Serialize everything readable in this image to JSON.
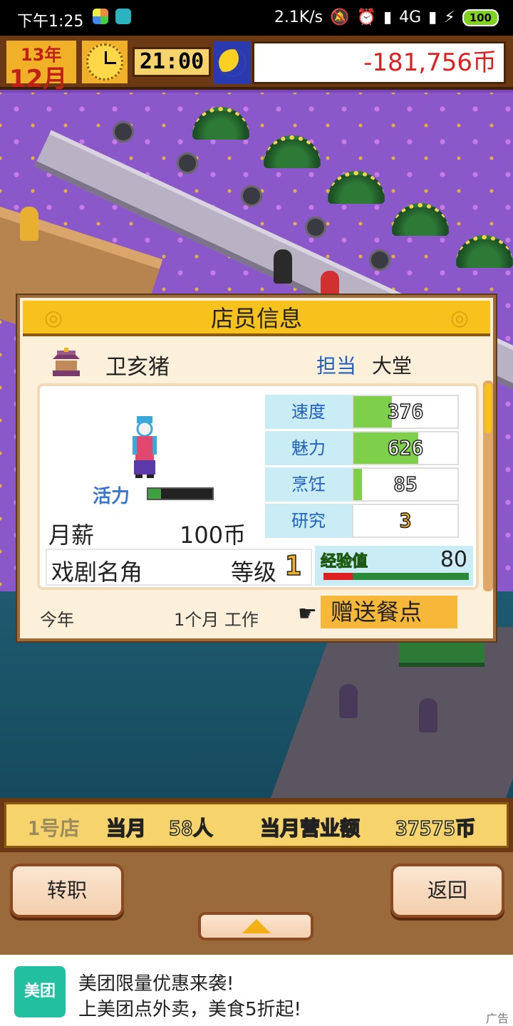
{
  "status_bar": {
    "time": "下午1:25",
    "network_speed": "2.1K/s",
    "network_type": "4G",
    "battery": "100"
  },
  "hud": {
    "year": "13年",
    "month": "12月",
    "time": "21:00",
    "money": "-181,756币"
  },
  "staff_dialog": {
    "title": "店员信息",
    "name": "卫亥猪",
    "dept_label": "担当",
    "dept_value": "大堂",
    "vitality_label": "活力",
    "vitality_level": 0.2,
    "salary_label": "月薪",
    "salary_value": "100币",
    "stats": [
      {
        "name": "速度",
        "value": "376",
        "fill": 0.37
      },
      {
        "name": "魅力",
        "value": "626",
        "fill": 0.62
      },
      {
        "name": "烹饪",
        "value": "85",
        "fill": 0.08
      },
      {
        "name": "研究",
        "value": "3",
        "fill": 0.0
      }
    ],
    "rank_title": "戏剧名角",
    "rank_label": "等级",
    "rank_value": "1",
    "exp_label": "经验值",
    "exp_value": "80",
    "exp_fill": 0.2,
    "footer_year": "今年",
    "footer_work": "1个月 工作",
    "gift_button": "赠送餐点"
  },
  "info_bar": {
    "shop": "1号店",
    "month_label": "当月",
    "visitors": "58人",
    "revenue_label": "当月营业额",
    "revenue": "37575币"
  },
  "buttons": {
    "transfer": "转职",
    "back": "返回"
  },
  "ad": {
    "logo": "美团",
    "title": "美团限量优惠来袭!",
    "subtitle": "上美团点外卖，美食5折起!",
    "mark": "广告"
  }
}
